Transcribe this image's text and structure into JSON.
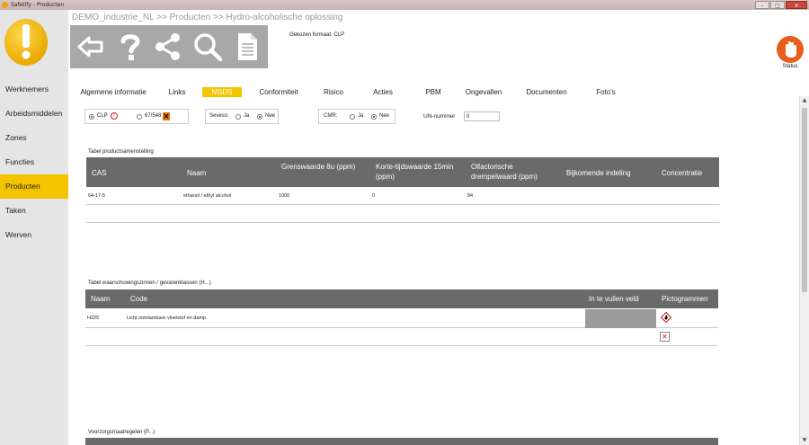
{
  "window": {
    "title": "Safetify - Producten"
  },
  "breadcrumb": "DEMO_industrie_NL >> Producten >> Hydro-alcoholische oplossing",
  "format": {
    "label": "Gekozen formaat: CLP"
  },
  "status": {
    "label": "Status"
  },
  "sidebar": {
    "items": [
      {
        "label": "Werknemers"
      },
      {
        "label": "Arbeidsmiddelen"
      },
      {
        "label": "Zones"
      },
      {
        "label": "Functies"
      },
      {
        "label": "Producten",
        "active": true
      },
      {
        "label": "Taken"
      },
      {
        "label": "Werven"
      }
    ]
  },
  "tabs": [
    {
      "label": "Algemene informatie"
    },
    {
      "label": "Links"
    },
    {
      "label": "MSDS",
      "active": true
    },
    {
      "label": "Conformiteit"
    },
    {
      "label": "Risico"
    },
    {
      "label": "Acties"
    },
    {
      "label": "PBM"
    },
    {
      "label": "Ongevallen"
    },
    {
      "label": "Documenten"
    },
    {
      "label": "Foto's"
    }
  ],
  "filters": {
    "clp_label": "CLP",
    "old_label": "67/548",
    "seveso_label": "Seveso:",
    "ja": "Ja",
    "nee": "Nee",
    "cmr_label": "CMR:",
    "un_label": "UN-nummer",
    "un_value": "0"
  },
  "composition": {
    "caption": "Tabel productsamenstelling",
    "headers": [
      "CAS",
      "Naam",
      "Grenswaarde 8u (ppm)",
      "Korte-tijdswaarde 15min (ppm)",
      "Olfactorische drempelwaard (ppm)",
      "Bijkomende indeling",
      "Concentratie"
    ],
    "rows": [
      {
        "cas": "64-17-5",
        "naam": "ethanol / ethyl alcohol",
        "grens": "1000",
        "kort": "0",
        "olf": "84",
        "bijk": "",
        "conc": ""
      }
    ]
  },
  "hazards": {
    "caption": "Tabel waarschuwingszinnen / gevarenklassen (H...)",
    "headers": [
      "Naam",
      "Code",
      "In te vullen veld",
      "Pictogrammen"
    ],
    "rows": [
      {
        "naam": "H225",
        "code": "Licht ontvlambare vloeistof en damp."
      }
    ]
  },
  "precautions": {
    "caption": "Voorzorgsmaatregelen (P...)"
  },
  "colors": {
    "accent": "#f5c400",
    "header": "#6a6a6a",
    "status": "#e85d19"
  }
}
